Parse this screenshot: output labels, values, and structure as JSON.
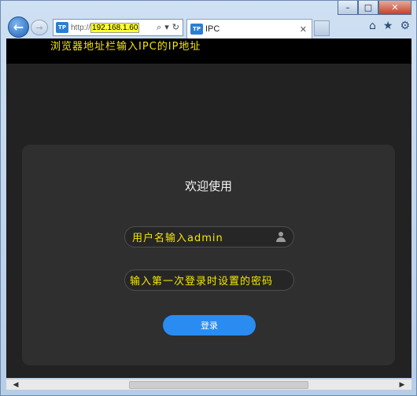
{
  "browser": {
    "address_prefix": "http://",
    "address_host": "192.168.1.60",
    "tab_title": "IPC",
    "tp_badge": "TP"
  },
  "banner": {
    "text": "浏览器地址栏输入IPC的IP地址"
  },
  "login": {
    "welcome": "欢迎使用",
    "username_text": "用户名输入admin",
    "password_text": "输入第一次登录时设置的密码",
    "login_button": "登录"
  },
  "colors": {
    "annotation_yellow": "#f2e600",
    "login_button_blue": "#2a8cf0",
    "page_background": "#222222"
  },
  "icons": [
    "back-arrow-icon",
    "forward-arrow-icon",
    "search-icon",
    "dropdown-icon",
    "refresh-icon",
    "close-icon",
    "home-icon",
    "favorites-star-icon",
    "settings-gear-icon",
    "user-icon"
  ]
}
